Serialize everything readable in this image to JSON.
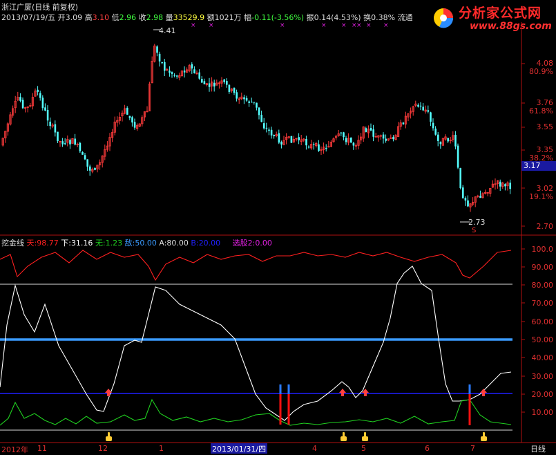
{
  "header": {
    "title": "浙江广厦(日线 前复权)",
    "date": "2013/07/19/五",
    "open_label": "开",
    "open": "3.09",
    "high_label": "高",
    "high": "3.10",
    "low_label": "低",
    "low": "2.96",
    "close_label": "收",
    "close": "2.98",
    "vol_label": "量",
    "vol": "33529.9",
    "amount_label": "额",
    "amount": "1021万",
    "chg_label": "幅",
    "chg": "-0.11",
    "chg_pct": "(-3.56%)",
    "amp_label": "振",
    "amp": "0.14(4.53%)",
    "turn_label": "换",
    "turn": "0.38%",
    "float_label": "流通"
  },
  "watermark": {
    "title": "分析家公式网",
    "url": "www.88gs.com"
  },
  "price_panel": {
    "high_marker": "4.41",
    "low_marker": "2.73",
    "current_price_tag": "3.17",
    "y_labels": [
      "4.08",
      "80.9%",
      "3.76",
      "61.8%",
      "3.55",
      "3.35",
      "38.2%",
      "3.02",
      "19.1%",
      "2.70"
    ],
    "sell_marker": "S"
  },
  "indicator_panel": {
    "name": "挖金线",
    "tian_label": "天:",
    "tian": "98.77",
    "xia_label": "下:",
    "xia": "31.16",
    "wu_label": "无:",
    "wu": "1.23",
    "di_label": "敌:",
    "di": "50.00",
    "a_label": "A:",
    "a": "80.00",
    "b_label": "B:",
    "b": "20.00",
    "xg_label": "选股2:",
    "xg": "0.00",
    "y_labels": [
      "100.0",
      "90.00",
      "80.00",
      "70.00",
      "60.00",
      "50.00",
      "40.00",
      "30.00",
      "20.00",
      "10.00"
    ]
  },
  "date_axis": {
    "year": "2012年",
    "m11": "11",
    "m12": "12",
    "m1": "1",
    "cursor_date": "2013/01/31/四",
    "m4": "4",
    "m5": "5",
    "m6": "6",
    "m7": "7",
    "period": "日线"
  },
  "colors": {
    "up": "#ff3b3b",
    "down": "#54ffff",
    "tian": "#ff2020",
    "xia": "#ffffff",
    "wu": "#20d020",
    "di": "#3a9bff",
    "b_line": "#2020ff",
    "frame": "#b01010"
  }
}
